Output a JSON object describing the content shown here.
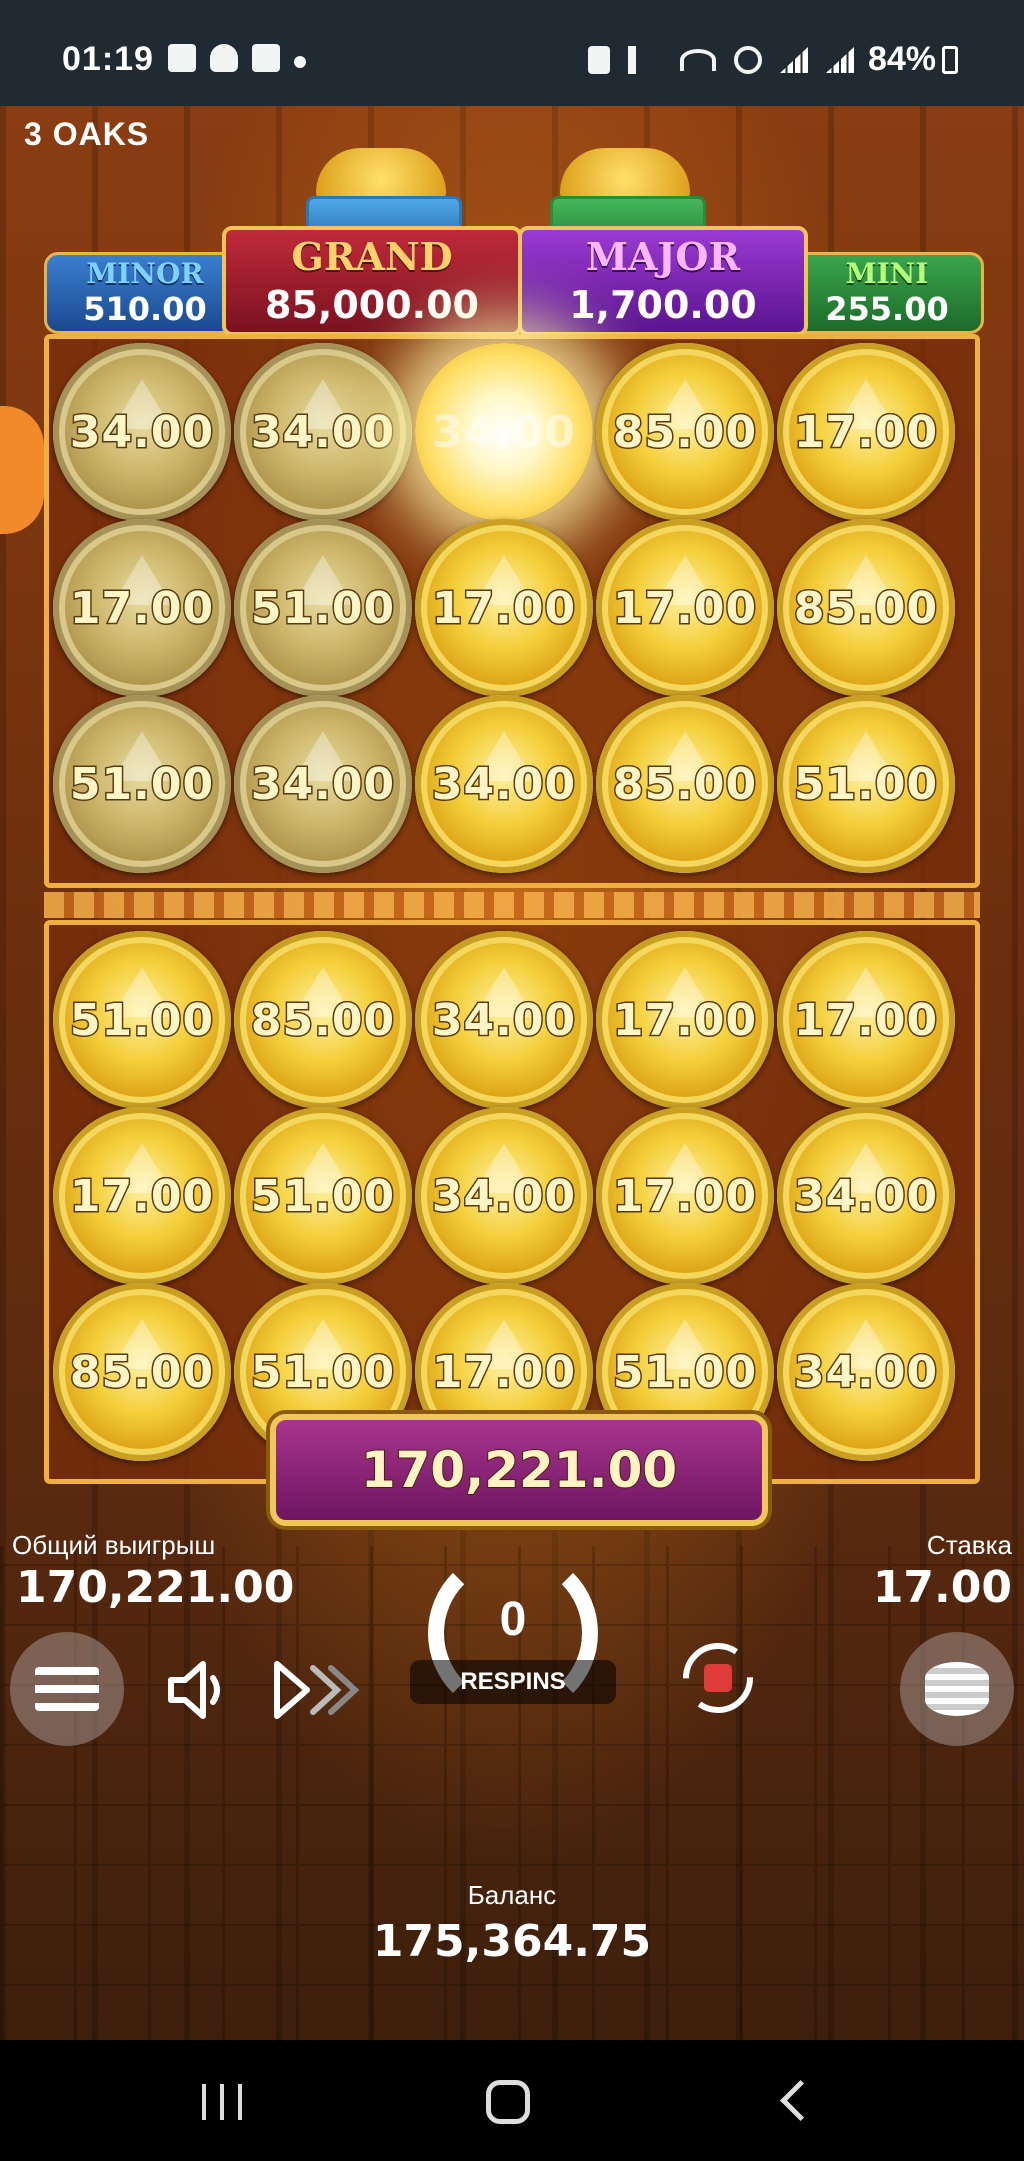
{
  "status_bar": {
    "time": "01:19",
    "battery": "84%"
  },
  "game": {
    "brand": "3 OAKS",
    "jackpots": {
      "minor": {
        "label": "MINOR",
        "value": "510.00"
      },
      "grand": {
        "label": "GRAND",
        "value": "85,000.00"
      },
      "major": {
        "label": "MAJOR",
        "value": "1,700.00"
      },
      "mini": {
        "label": "MINI",
        "value": "255.00"
      }
    },
    "top_grid": [
      [
        "34.00",
        "34.00",
        "34.00",
        "85.00",
        "17.00"
      ],
      [
        "17.00",
        "51.00",
        "17.00",
        "17.00",
        "85.00"
      ],
      [
        "51.00",
        "34.00",
        "34.00",
        "85.00",
        "51.00"
      ]
    ],
    "bottom_grid": [
      [
        "51.00",
        "85.00",
        "34.00",
        "17.00",
        "17.00"
      ],
      [
        "17.00",
        "51.00",
        "34.00",
        "17.00",
        "34.00"
      ],
      [
        "85.00",
        "51.00",
        "17.00",
        "51.00",
        "34.00"
      ]
    ],
    "total_win_banner": "170,221.00",
    "total_win_label": "Общий выигрыш",
    "total_win_value": "170,221.00",
    "bet_label": "Ставка",
    "bet_value": "17.00",
    "respins_count": "0",
    "respins_label": "RESPINS",
    "balance_label": "Баланс",
    "balance_value": "175,364.75"
  }
}
